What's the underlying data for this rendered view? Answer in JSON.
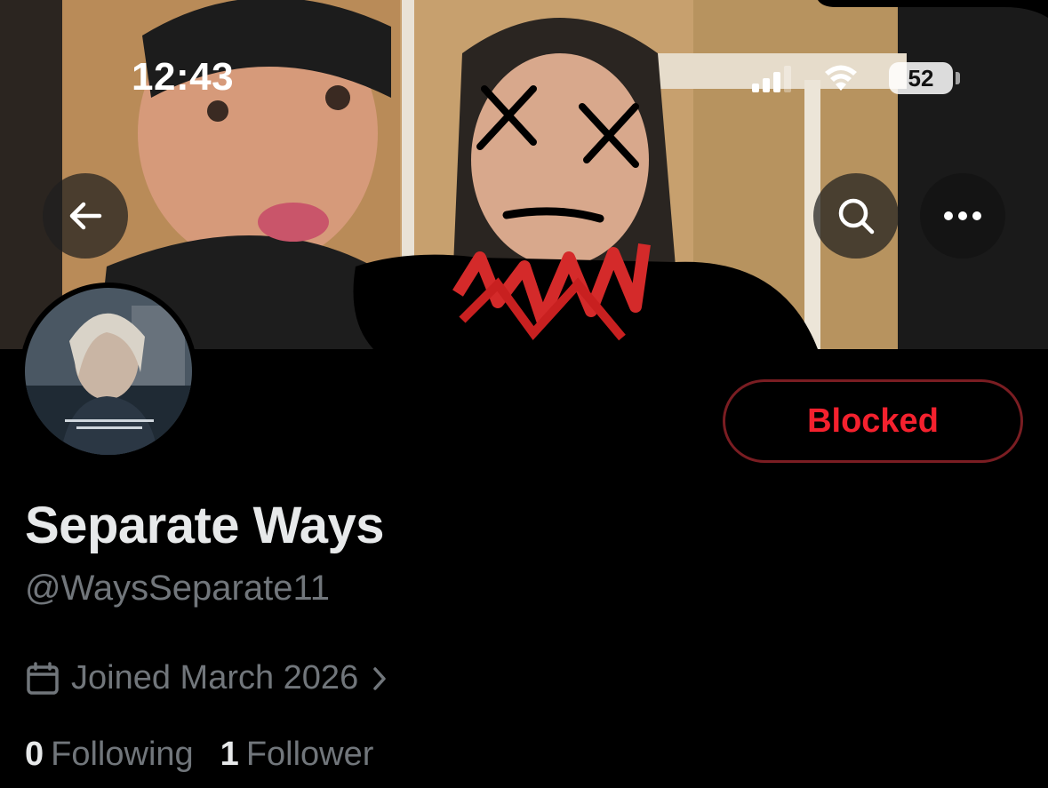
{
  "status_bar": {
    "time": "12:43",
    "battery": "52",
    "signal_icon": "cellular-signal-icon",
    "wifi_icon": "wifi-icon"
  },
  "header": {
    "back_icon": "arrow-left-icon",
    "search_icon": "search-icon",
    "more_icon": "more-dots-icon"
  },
  "profile": {
    "display_name": "Separate Ways",
    "handle": "@WaysSeparate11",
    "joined": "Joined March 2026",
    "joined_icon": "calendar-icon",
    "following_count": "0",
    "following_label": "Following",
    "followers_count": "1",
    "followers_label": "Follower"
  },
  "actions": {
    "blocked_label": "Blocked"
  },
  "colors": {
    "background": "#000000",
    "text_primary": "#e7e9ea",
    "text_secondary": "#71767b",
    "blocked_red": "#f4212e",
    "blocked_border": "#7a1d22"
  }
}
